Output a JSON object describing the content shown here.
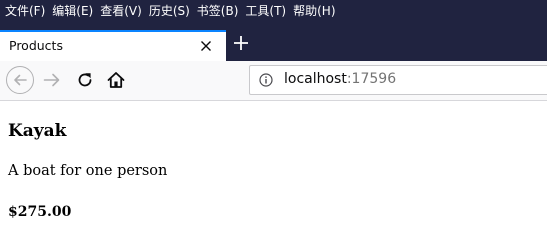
{
  "menu": {
    "items": [
      "文件(F)",
      "编辑(E)",
      "查看(V)",
      "历史(S)",
      "书签(B)",
      "工具(T)",
      "帮助(H)"
    ]
  },
  "tab": {
    "title": "Products",
    "close_icon": "close-icon",
    "new_tab_icon": "plus-icon"
  },
  "navbar": {
    "back_icon": "arrow-left-icon",
    "forward_icon": "arrow-right-icon",
    "reload_icon": "reload-icon",
    "home_icon": "home-icon"
  },
  "address": {
    "info_icon": "info-icon",
    "host": "localhost",
    "port": ":17596"
  },
  "page": {
    "name": "Kayak",
    "description": "A boat for one person",
    "price": "$275.00"
  },
  "colors": {
    "chrome_dark": "#202340",
    "tab_accent": "#0a84ff",
    "navbar_bg": "#f9f9fa"
  }
}
